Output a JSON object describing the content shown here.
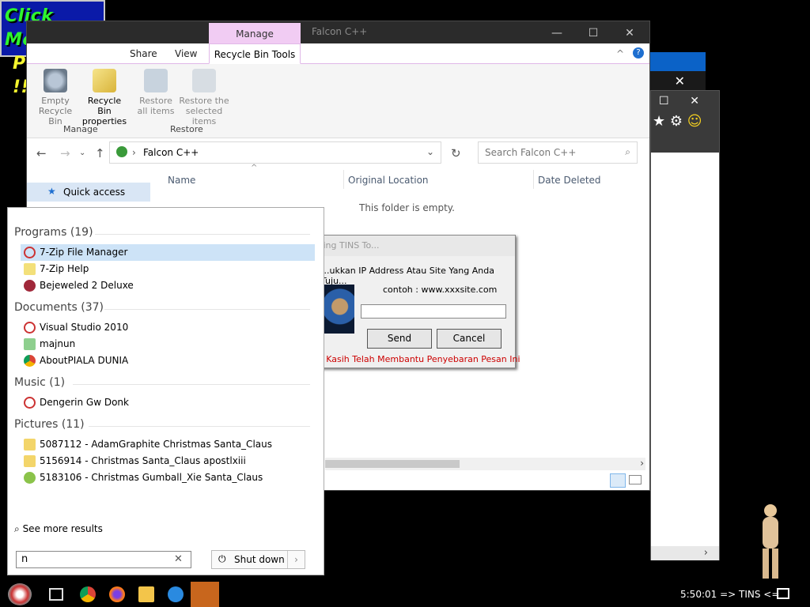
{
  "banner": {
    "line1": "Click Me...",
    "line2": "Please !!!"
  },
  "explorer": {
    "title": "Falcon C++",
    "manage_tab": "Manage",
    "tabs": [
      "Share",
      "View"
    ],
    "recycle_tools_tab": "Recycle Bin Tools",
    "ribbon": {
      "empty": [
        "Empty",
        "Recycle Bin"
      ],
      "properties": [
        "Recycle Bin",
        "properties"
      ],
      "restore_all": [
        "Restore",
        "all items"
      ],
      "restore_selected": [
        "Restore the",
        "selected items"
      ],
      "group_manage": "Manage",
      "group_restore": "Restore"
    },
    "address": "Falcon C++",
    "search_placeholder": "Search Falcon C++",
    "nav": {
      "quick_access": "Quick access"
    },
    "columns": [
      "Name",
      "Original Location",
      "Date Deleted"
    ],
    "empty_message": "This folder is empty."
  },
  "dialog": {
    "title": "...ing TINS To...",
    "prompt": "...ukkan IP Address Atau Site Yang Anda Tuju...",
    "example": "contoh : www.xxxsite.com",
    "send_label": "Send",
    "cancel_label": "Cancel",
    "footer": "a Kasih Telah Membantu Penyebaran Pesan Ini"
  },
  "start_panel": {
    "programs_header": "Programs (19)",
    "programs": [
      "7-Zip File Manager",
      "7-Zip Help",
      "Bejeweled 2 Deluxe"
    ],
    "documents_header": "Documents (37)",
    "documents": [
      "Visual Studio 2010",
      "majnun",
      "AboutPIALA DUNIA"
    ],
    "music_header": "Music (1)",
    "music": [
      "Dengerin Gw Donk"
    ],
    "pictures_header": "Pictures (11)",
    "pictures": [
      "5087112 - AdamGraphite Christmas Santa_Claus",
      "5156914 - Christmas Santa_Claus apostlxiii",
      "5183106 - Christmas Gumball_Xie Santa_Claus"
    ],
    "see_more": "See more results",
    "search_value": "n",
    "shutdown_label": "Shut down"
  },
  "taskbar": {
    "clock": "5:50:01 => TINS <="
  },
  "colors": {
    "accent_selection": "#cde3f7",
    "manage_tab": "#f1ccf3",
    "banner_bg": "#0a1aa8"
  }
}
